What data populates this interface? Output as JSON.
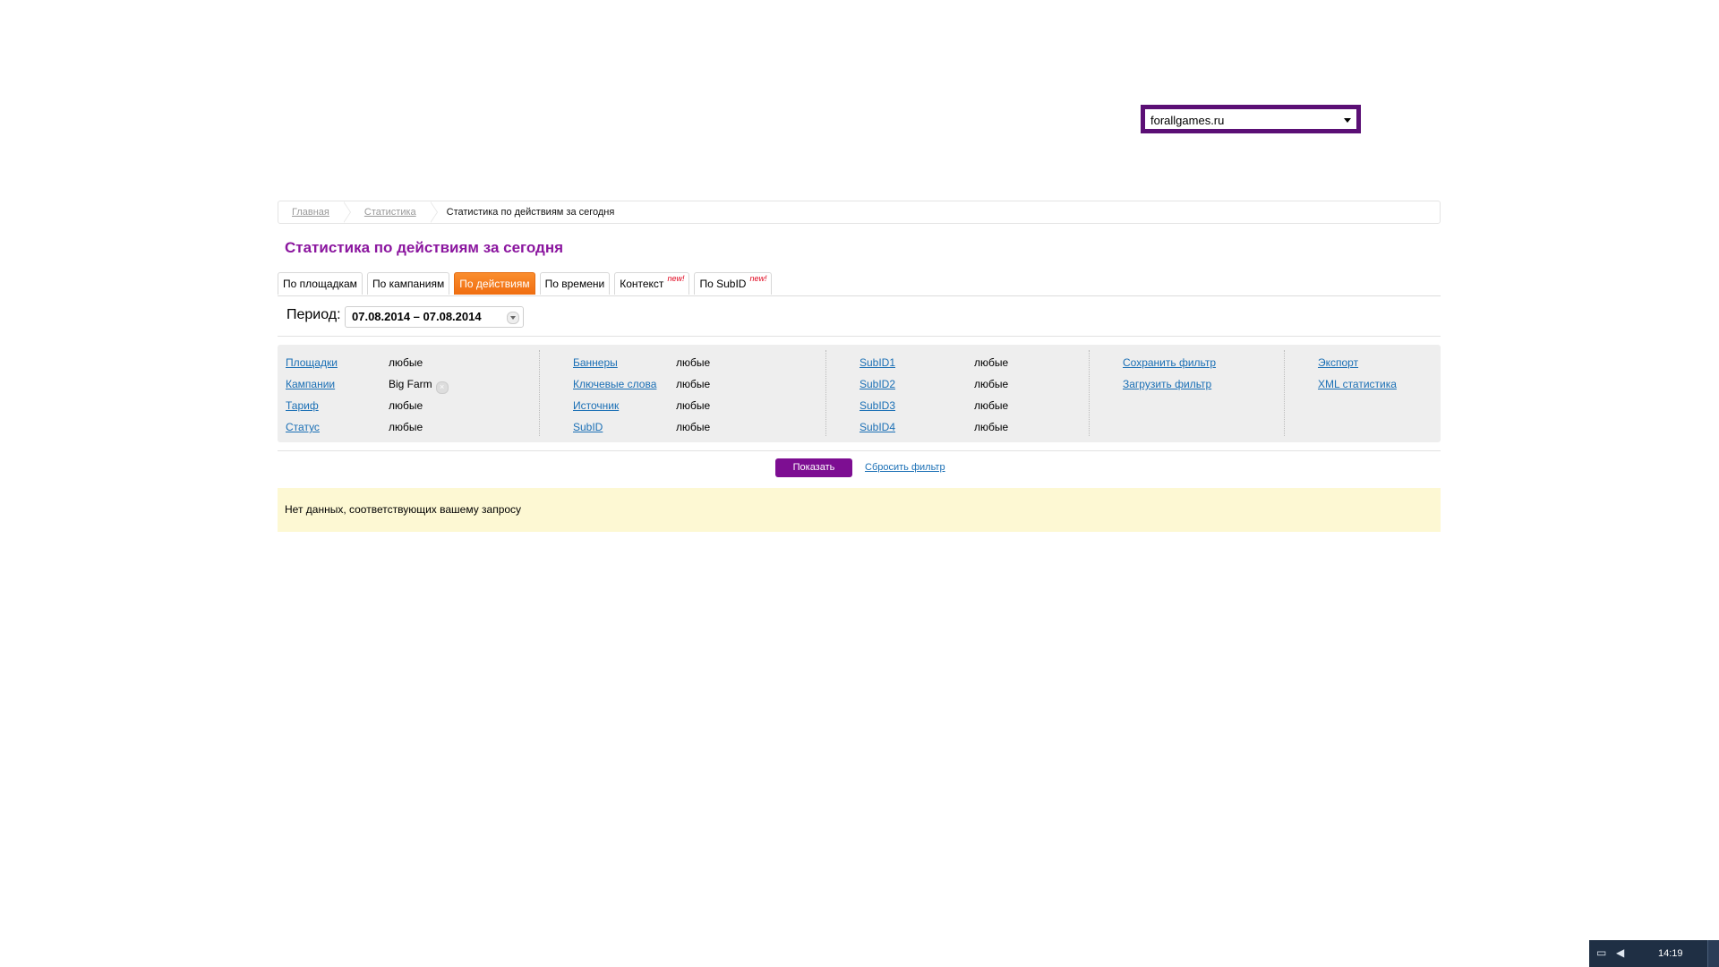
{
  "site_select": {
    "value": "forallgames.ru"
  },
  "breadcrumb": {
    "items": [
      "Главная",
      "Статистика",
      "Статистика по действиям за сегодня"
    ]
  },
  "page_title": "Статистика по действиям за сегодня",
  "tabs": [
    {
      "label": "По площадкам",
      "active": false
    },
    {
      "label": "По кампаниям",
      "active": false
    },
    {
      "label": "По действиям",
      "active": true
    },
    {
      "label": "По времени",
      "active": false
    },
    {
      "label": "Контекст",
      "badge": "new!",
      "active": false
    },
    {
      "label": "По SubID",
      "badge": "new!",
      "active": false
    }
  ],
  "period": {
    "label": "Период:",
    "value": "07.08.2014 – 07.08.2014"
  },
  "filters": {
    "col1": [
      {
        "label": "Площадки",
        "value": "любые"
      },
      {
        "label": "Кампании",
        "value": "Big Farm"
      },
      {
        "label": "Тариф",
        "value": "любые"
      },
      {
        "label": "Статус",
        "value": "любые"
      }
    ],
    "col2": [
      {
        "label": "Баннеры",
        "value": "любые"
      },
      {
        "label": "Ключевые слова",
        "value": "любые"
      },
      {
        "label": "Источник",
        "value": "любые"
      },
      {
        "label": "SubID",
        "value": "любые"
      }
    ],
    "col3": [
      {
        "label": "SubID1",
        "value": "любые"
      },
      {
        "label": "SubID2",
        "value": "любые"
      },
      {
        "label": "SubID3",
        "value": "любые"
      },
      {
        "label": "SubID4",
        "value": "любые"
      }
    ],
    "actions": [
      "Сохранить фильтр",
      "Загрузить фильтр"
    ],
    "export": [
      "Экспорт",
      "XML статистика"
    ]
  },
  "buttons": {
    "show": "Показать",
    "reset": "Сбросить фильтр"
  },
  "no_data_message": "Нет данных, соответствующих вашему запросу",
  "taskbar": {
    "clock": "14:19"
  },
  "colors": {
    "accent_purple": "#7d0e92",
    "title_purple": "#8b169f",
    "active_tab_orange": "#f27a1a",
    "notice_bg": "#fdf8d3"
  }
}
